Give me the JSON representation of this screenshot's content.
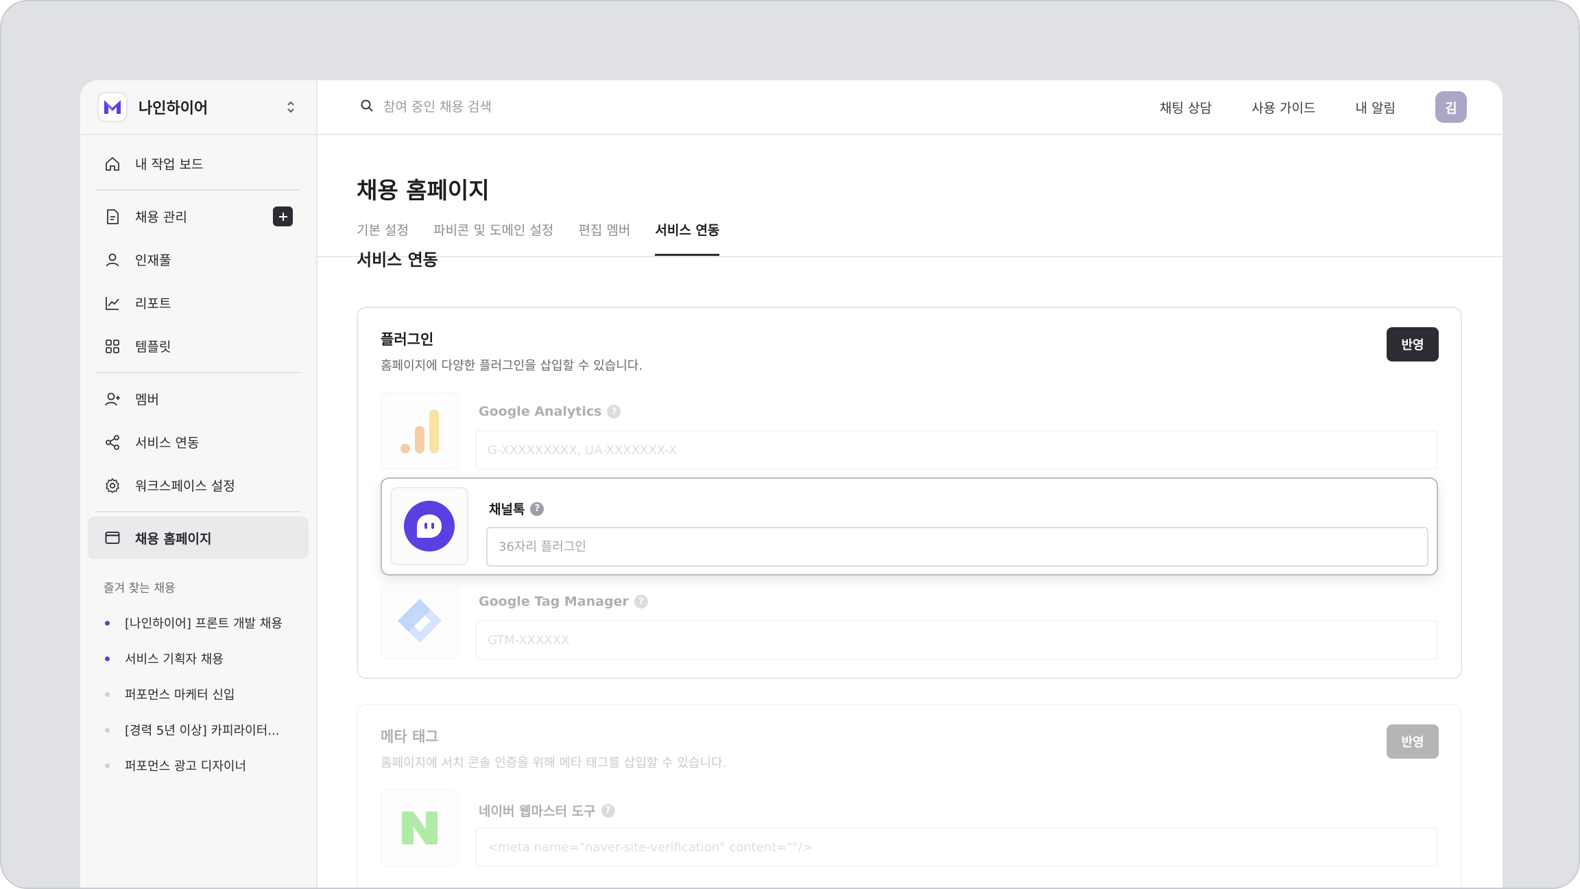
{
  "workspace": {
    "name": "나인하이어"
  },
  "sidebar": {
    "items": [
      {
        "label": "내 작업 보드",
        "icon": "home-icon"
      },
      {
        "label": "채용 관리",
        "icon": "document-icon"
      },
      {
        "label": "인재풀",
        "icon": "person-icon"
      },
      {
        "label": "리포트",
        "icon": "chart-line-icon"
      },
      {
        "label": "템플릿",
        "icon": "grid-icon"
      },
      {
        "label": "멤버",
        "icon": "person-add-icon"
      },
      {
        "label": "서비스 연동",
        "icon": "share-icon"
      },
      {
        "label": "워크스페이스 설정",
        "icon": "gear-icon"
      },
      {
        "label": "채용 홈페이지",
        "icon": "browser-window-icon"
      }
    ],
    "favorites_title": "즐겨 찾는 채용",
    "favorites": [
      {
        "label": "[나인하이어] 프론트 개발 채용",
        "active": true
      },
      {
        "label": "서비스 기획자 채용",
        "active": true
      },
      {
        "label": "퍼포먼스 마케터 신입",
        "active": false
      },
      {
        "label": "[경력 5년 이상] 카피라이터...",
        "active": false
      },
      {
        "label": "퍼포먼스 광고 디자이너",
        "active": false
      }
    ]
  },
  "topbar": {
    "search_placeholder": "참여 중인 채용 검색",
    "links": [
      "채팅 상담",
      "사용 가이드",
      "내 알림"
    ],
    "avatar": "김"
  },
  "main": {
    "title": "채용 홈페이지",
    "tabs": [
      "기본 설정",
      "파비콘 및 도메인 설정",
      "편집 멤버",
      "서비스 연동"
    ],
    "active_tab": "서비스 연동",
    "section_title": "서비스 연동",
    "plugin_card": {
      "title": "플러그인",
      "description": "홈페이지에 다양한 플러그인을 삽입할 수 있습니다.",
      "apply_label": "반영",
      "plugins": [
        {
          "name": "Google Analytics",
          "placeholder": "G-XXXXXXXXX, UA-XXXXXXX-X",
          "icon": "google-analytics-icon"
        },
        {
          "name": "채널톡",
          "placeholder": "36자리 플러그인",
          "icon": "channel-talk-icon"
        },
        {
          "name": "Google Tag Manager",
          "placeholder": "GTM-XXXXXX",
          "icon": "google-tag-manager-icon"
        }
      ]
    },
    "meta_card": {
      "title": "메타 태그",
      "description": "홈페이지에 서치 콘솔 인증을 위해 메타 태그를 삽입할 수 있습니다.",
      "apply_label": "반영",
      "tools": [
        {
          "name": "네이버 웹마스터 도구",
          "placeholder": "<meta name=\"naver-site-verification\" content=\"\"/>",
          "icon": "naver-icon"
        }
      ]
    }
  },
  "colors": {
    "accent": "#5b3fe0",
    "dark_button": "#2b2d33",
    "naver_green": "#1ec800"
  }
}
